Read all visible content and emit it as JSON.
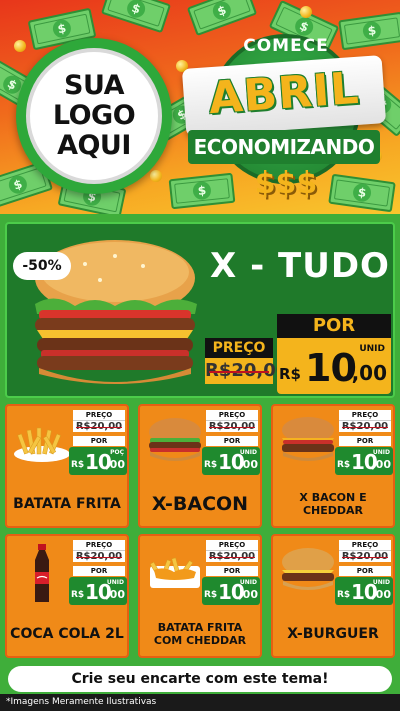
{
  "header": {
    "logo_lines": [
      "SUA",
      "LOGO",
      "AQUI"
    ],
    "badge": {
      "comece": "COMECE",
      "abril": "ABRIL",
      "economizando": "ECONOMIZANDO",
      "dollars": "$$$"
    }
  },
  "featured": {
    "discount": "-50%",
    "name": "X - TUDO",
    "preco_label": "PREÇO",
    "old_price": "R$20,00",
    "por_label": "POR",
    "currency": "R$",
    "price_int": "10",
    "price_dec": ",00",
    "unit": "UNID"
  },
  "products": [
    {
      "name": "BATATA FRITA",
      "preco_label": "PREÇO",
      "old_price": "R$20,00",
      "por_label": "POR",
      "currency": "R$",
      "price_int": "10",
      "price_dec": ",00",
      "unit": "POÇ",
      "icon": "fries"
    },
    {
      "name": "X-BACON",
      "preco_label": "PREÇO",
      "old_price": "R$20,00",
      "por_label": "POR",
      "currency": "R$",
      "price_int": "10",
      "price_dec": ",00",
      "unit": "UNID",
      "icon": "burger"
    },
    {
      "name": "X BACON E CHEDDAR",
      "preco_label": "PREÇO",
      "old_price": "R$20,00",
      "por_label": "POR",
      "currency": "R$",
      "price_int": "10",
      "price_dec": ",00",
      "unit": "UNID",
      "icon": "burger-cheddar"
    },
    {
      "name": "COCA COLA 2L",
      "preco_label": "PREÇO",
      "old_price": "R$20,00",
      "por_label": "POR",
      "currency": "R$",
      "price_int": "10",
      "price_dec": ",00",
      "unit": "UNID",
      "icon": "soda-bottle"
    },
    {
      "name": "BATATA FRITA COM CHEDDAR",
      "preco_label": "PREÇO",
      "old_price": "R$20,00",
      "por_label": "POR",
      "currency": "R$",
      "price_int": "10",
      "price_dec": ",00",
      "unit": "UNID",
      "icon": "fries-cheddar"
    },
    {
      "name": "X-BURGUER",
      "preco_label": "PREÇO",
      "old_price": "R$20,00",
      "por_label": "POR",
      "currency": "R$",
      "price_int": "10",
      "price_dec": ",00",
      "unit": "UNID",
      "icon": "burger"
    }
  ],
  "cta": "Crie seu encarte com este tema!",
  "disclaimer": "*Imagens Meramente Ilustrativas",
  "colors": {
    "header_red": "#e8361b",
    "header_yellow": "#f9c62d",
    "brand_green": "#3fae3a",
    "dark_green": "#1f7a2a",
    "card_orange": "#f08a18",
    "price_yellow": "#f4b41c"
  }
}
